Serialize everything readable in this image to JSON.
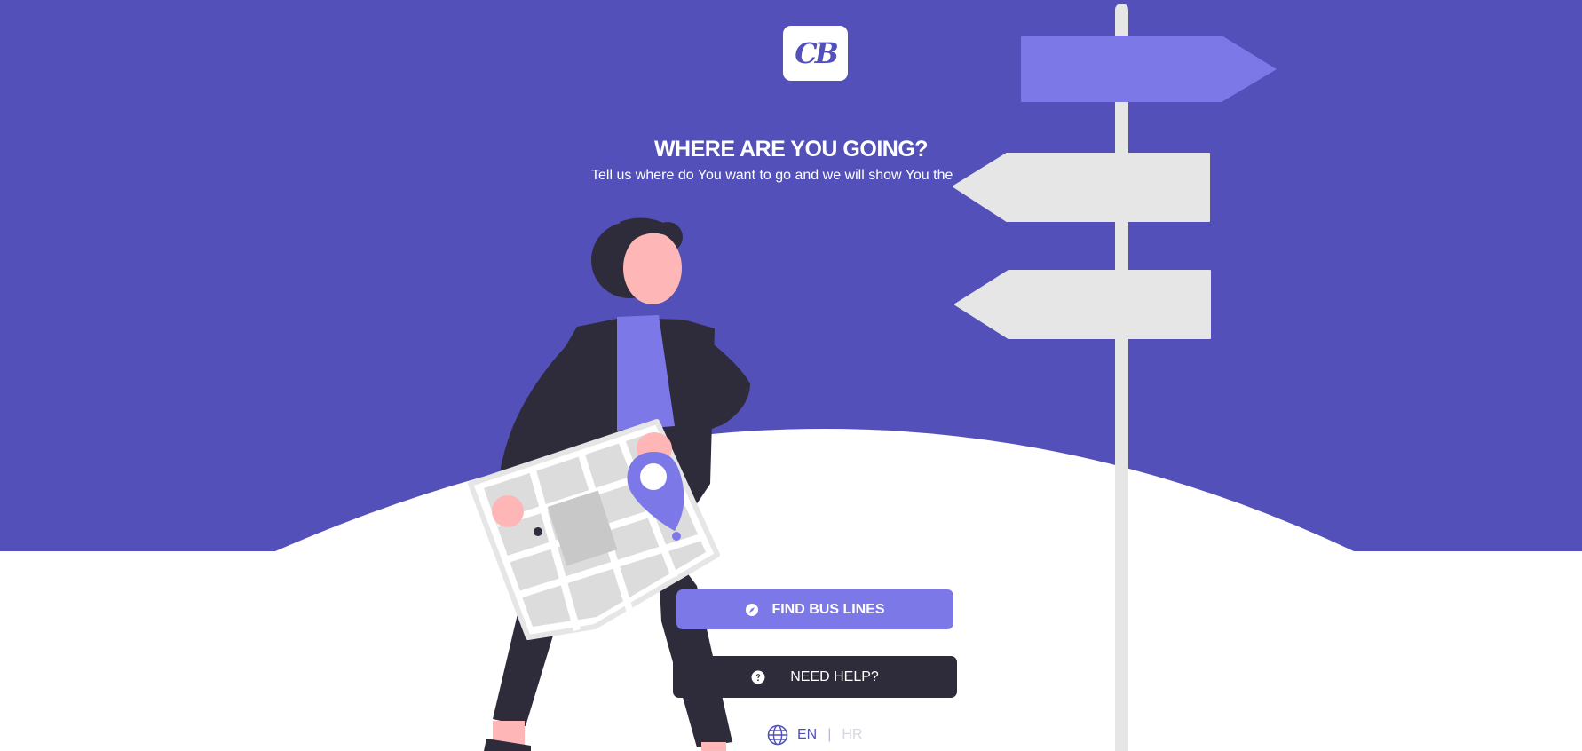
{
  "logo": {
    "text": "CB"
  },
  "hero": {
    "title": "WHERE ARE YOU GOING?",
    "subtitle": "Tell us where do You want to go and we will show You the"
  },
  "actions": {
    "find_bus_lines": {
      "label": "FIND BUS LINES",
      "icon": "compass-icon"
    },
    "need_help": {
      "label": "NEED HELP?",
      "icon": "question-circle-icon"
    }
  },
  "language": {
    "icon": "globe-icon",
    "options": [
      "EN",
      "HR"
    ],
    "separator": "|",
    "selected": "EN"
  },
  "colors": {
    "brand": "#5351b9",
    "accent": "#7c78e8",
    "dark": "#2e2c3b",
    "sign_gray": "#e6e6e6"
  }
}
